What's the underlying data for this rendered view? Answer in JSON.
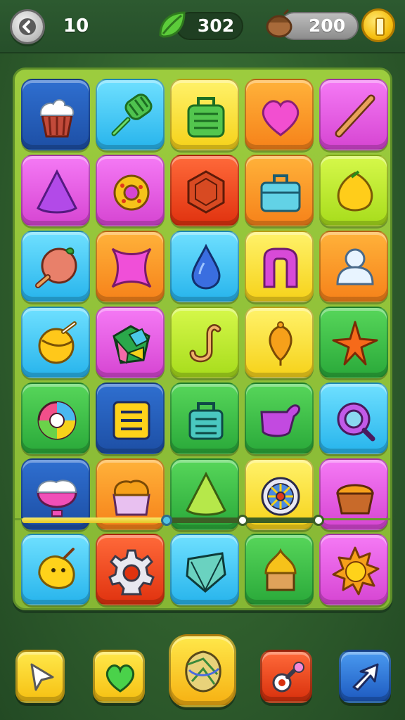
{
  "header": {
    "level": "10",
    "leaves": "302",
    "coins": "200"
  },
  "board": {
    "rows": [
      [
        {
          "item": "cupcake-icon",
          "color": "#1d4fa5"
        },
        {
          "item": "green-popsicle-icon",
          "color": "#27b4ec"
        },
        {
          "item": "green-bag-icon",
          "color": "#f6d21a"
        },
        {
          "item": "pink-heart-icon",
          "color": "#f6821a"
        },
        {
          "item": "stick-icon",
          "color": "#d645d2"
        }
      ],
      [
        {
          "item": "purple-cone-icon",
          "color": "#d645d2"
        },
        {
          "item": "donut-icon",
          "color": "#d645d2"
        },
        {
          "item": "hexagon-gem-icon",
          "color": "#e0320f"
        },
        {
          "item": "lunchbox-icon",
          "color": "#f6821a"
        },
        {
          "item": "lemon-icon",
          "color": "#a7dc1c"
        }
      ],
      [
        {
          "item": "peach-icon",
          "color": "#27b4ec"
        },
        {
          "item": "pink-star-icon",
          "color": "#f6821a"
        },
        {
          "item": "water-drop-icon",
          "color": "#27b4ec"
        },
        {
          "item": "magnet-icon",
          "color": "#f6d21a"
        },
        {
          "item": "snowman-icon",
          "color": "#f6821a"
        }
      ],
      [
        {
          "item": "planet-icon",
          "color": "#27b4ec"
        },
        {
          "item": "gift-box-icon",
          "color": "#d645d2"
        },
        {
          "item": "hook-icon",
          "color": "#a7dc1c"
        },
        {
          "item": "balloon-icon",
          "color": "#f6d21a"
        },
        {
          "item": "orange-star-icon",
          "color": "#2aa93a"
        }
      ],
      [
        {
          "item": "swirl-candy-icon",
          "color": "#2aa93a"
        },
        {
          "item": "note-card-icon",
          "color": "#1d4fa5"
        },
        {
          "item": "teal-bag-icon",
          "color": "#2aa93a"
        },
        {
          "item": "purple-mitten-icon",
          "color": "#2aa93a"
        },
        {
          "item": "ring-icon",
          "color": "#27b4ec"
        }
      ],
      [
        {
          "item": "ice-cream-cup-icon",
          "color": "#1d4fa5"
        },
        {
          "item": "muffin-icon",
          "color": "#f6821a"
        },
        {
          "item": "green-cone-icon",
          "color": "#2aa93a"
        },
        {
          "item": "wheel-icon",
          "color": "#f6d21a"
        },
        {
          "item": "pudding-icon",
          "color": "#d645d2"
        }
      ]
    ],
    "tray": [
      {
        "item": "lemon-creature-icon",
        "color": "#27b4ec"
      },
      {
        "item": "gear-icon",
        "color": "#e0320f"
      },
      {
        "item": "leaf-gem-icon",
        "color": "#27b4ec"
      },
      {
        "item": "honey-jar-icon",
        "color": "#2aa93a"
      },
      {
        "item": "sun-icon",
        "color": "#d645d2"
      }
    ],
    "progress": {
      "fill_fraction": 0.49,
      "stars": 3,
      "reached": 1
    }
  },
  "toolbar": {
    "items": [
      {
        "name": "play-button",
        "icon": "arrow-icon",
        "color": "#f6c012"
      },
      {
        "name": "heart-button",
        "icon": "heart-icon",
        "color": "#f6d21a"
      },
      {
        "name": "shuffle-button",
        "icon": "shield-icon",
        "color": "#f6c012"
      },
      {
        "name": "key-button",
        "icon": "key-icon",
        "color": "#e0320f"
      },
      {
        "name": "hint-button",
        "icon": "pointer-icon",
        "color": "#1d4fa5"
      }
    ]
  }
}
